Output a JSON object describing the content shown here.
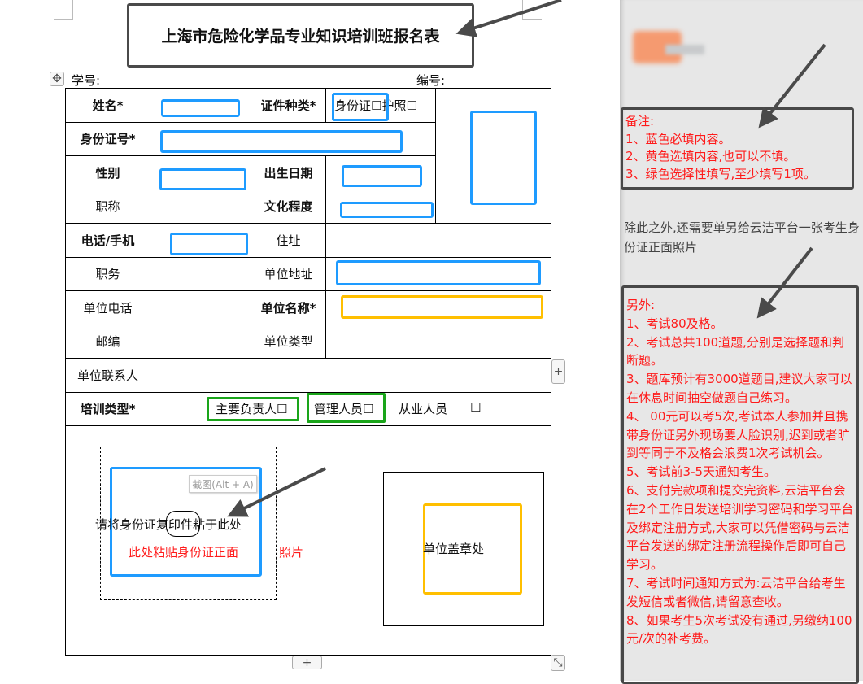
{
  "title": "上海市危险化学品专业知识培训班报名表",
  "header": {
    "student_no": "学号:",
    "serial_no": "编号:"
  },
  "form": {
    "name": "姓名*",
    "id_type": "证件种类*",
    "id_type_options": "身份证☐护照☐",
    "id_number": "身份证号*",
    "gender": "性别",
    "birth_date": "出生日期",
    "title": "职称",
    "education": "文化程度",
    "phone": "电话/手机",
    "address": "住址",
    "position": "职务",
    "company_address": "单位地址",
    "company_phone": "单位电话",
    "company_name": "单位名称*",
    "postcode": "邮编",
    "company_type": "单位类型",
    "company_contact": "单位联系人",
    "training_type": "培训类型*",
    "training_options": [
      "主要负责人☐",
      "管理人员☐",
      "从业人员",
      "☐"
    ],
    "paste_id_instruction": "请将身份证复印件粘于此处",
    "paste_id_red": "此处粘贴身份证正面",
    "paste_id_red_tail": "照片",
    "screenshot_tooltip": "截图(Alt + A)",
    "stamp": "单位盖章处"
  },
  "controls": {
    "add_row": "+",
    "add_col": "+",
    "move_handle": "✥",
    "resize_handle": "⤡"
  },
  "side": {
    "note_title": "备注:",
    "notes": [
      "1、蓝色必填内容。",
      "2、黄色选填内容,也可以不填。",
      "3、绿色选择性填写,至少填写1项。"
    ],
    "extra_text": "除此之外,还需要单另给云洁平台一张考生身份证正面照片",
    "other_title": "另外:",
    "others": [
      "1、考试80及格。",
      "2、考试总共100道题,分别是选择题和判断题。",
      "3、题库预计有3000道题目,建议大家可以在休息时间抽空做题自己练习。",
      "4、 00元可以考5次,考试本人参加并且携带身份证另外现场要人脸识别,迟到或者旷到等同于不及格会浪费1次考试机会。",
      "5、考试前3-5天通知考生。",
      "6、支付完款项和提交完资料,云洁平台会在2个工作日发送培训学习密码和学习平台及绑定注册方式,大家可以凭借密码与云洁平台发送的绑定注册流程操作后即可自己学习。",
      "7、考试时间通知方式为:云洁平台给考生发短信或者微信,请留意查收。",
      "8、如果考生5次考试没有通过,另缴纳100元/次的补考费。"
    ]
  },
  "colors": {
    "required": "#1e9bff",
    "optional": "#ffbf00",
    "choice": "#1aa51a",
    "note_text": "#ff1a1a"
  }
}
